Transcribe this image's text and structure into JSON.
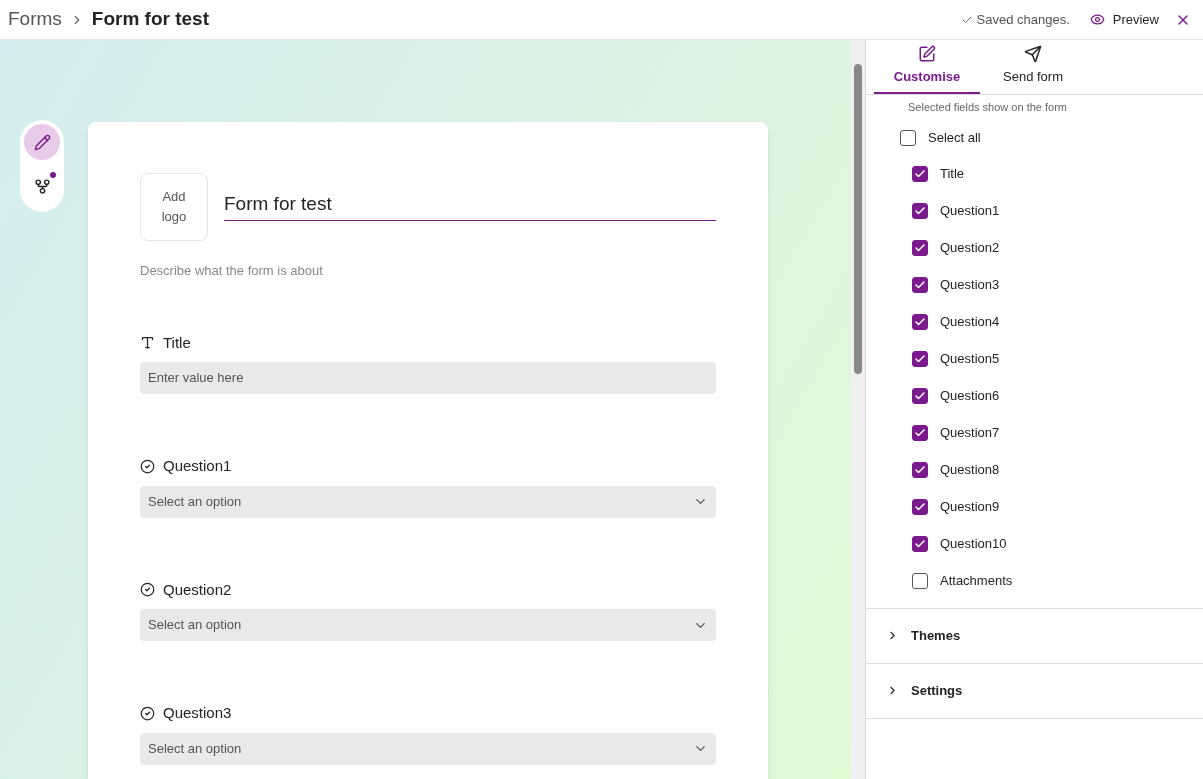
{
  "breadcrumb": {
    "root": "Forms",
    "current": "Form for test"
  },
  "header_actions": {
    "status": "Saved changes.",
    "preview": "Preview"
  },
  "toolbar": [
    {
      "kind": "edit",
      "selected": true,
      "badge": false
    },
    {
      "kind": "branch",
      "selected": false,
      "badge": true
    }
  ],
  "form": {
    "logo_label": "Add logo",
    "title": "Form for test",
    "description_placeholder": "Describe what the form is about",
    "fields": [
      {
        "kind": "text",
        "label": "Title",
        "placeholder": "Enter value here"
      },
      {
        "kind": "choice",
        "label": "Question1",
        "placeholder": "Select an option"
      },
      {
        "kind": "choice",
        "label": "Question2",
        "placeholder": "Select an option"
      },
      {
        "kind": "choice",
        "label": "Question3",
        "placeholder": "Select an option"
      }
    ]
  },
  "panel": {
    "tabs": [
      {
        "label": "Customise",
        "kind": "customise",
        "selected": true
      },
      {
        "label": "Send form",
        "kind": "send",
        "selected": false
      }
    ],
    "hint": "Selected fields show on the form",
    "select_all": {
      "label": "Select all",
      "checked": false
    },
    "fields": [
      {
        "label": "Title",
        "checked": true
      },
      {
        "label": "Question1",
        "checked": true
      },
      {
        "label": "Question2",
        "checked": true
      },
      {
        "label": "Question3",
        "checked": true
      },
      {
        "label": "Question4",
        "checked": true
      },
      {
        "label": "Question5",
        "checked": true
      },
      {
        "label": "Question6",
        "checked": true
      },
      {
        "label": "Question7",
        "checked": true
      },
      {
        "label": "Question8",
        "checked": true
      },
      {
        "label": "Question9",
        "checked": true
      },
      {
        "label": "Question10",
        "checked": true
      },
      {
        "label": "Attachments",
        "checked": false
      }
    ],
    "sections": [
      {
        "label": "Themes",
        "expanded": false
      },
      {
        "label": "Settings",
        "expanded": false
      }
    ]
  }
}
